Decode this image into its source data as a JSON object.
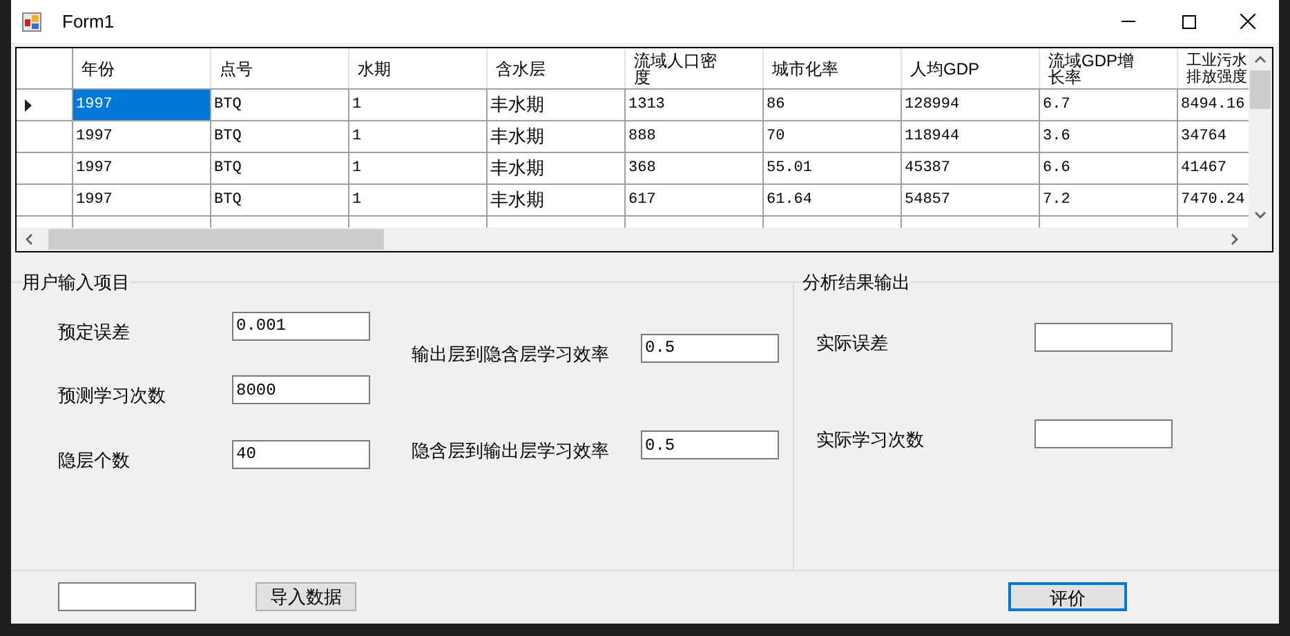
{
  "window": {
    "title": "Form1"
  },
  "table": {
    "columns": [
      "年份",
      "点号",
      "水期",
      "含水层",
      "流域人口密度",
      "城市化率",
      "人均GDP",
      "流域GDP增长率",
      "工业污水排放强度"
    ],
    "rows": [
      {
        "current": true,
        "cells": [
          {
            "text": "1997",
            "selected": true
          },
          {
            "text": "BTQ",
            "selected": false
          },
          {
            "text": "1",
            "selected": false
          },
          {
            "text": "丰水期",
            "selected": false
          },
          {
            "text": "1313",
            "selected": false
          },
          {
            "text": "86",
            "selected": false
          },
          {
            "text": "128994",
            "selected": false
          },
          {
            "text": "6.7",
            "selected": false
          },
          {
            "text": "8494.16",
            "selected": false
          }
        ]
      },
      {
        "current": false,
        "cells": [
          {
            "text": "1997",
            "selected": false
          },
          {
            "text": "BTQ",
            "selected": false
          },
          {
            "text": "1",
            "selected": false
          },
          {
            "text": "丰水期",
            "selected": false
          },
          {
            "text": "888",
            "selected": false
          },
          {
            "text": "70",
            "selected": false
          },
          {
            "text": "118944",
            "selected": false
          },
          {
            "text": "3.6",
            "selected": false
          },
          {
            "text": "34764",
            "selected": false
          }
        ]
      },
      {
        "current": false,
        "cells": [
          {
            "text": "1997",
            "selected": false
          },
          {
            "text": "BTQ",
            "selected": false
          },
          {
            "text": "1",
            "selected": false
          },
          {
            "text": "丰水期",
            "selected": false
          },
          {
            "text": "368",
            "selected": false
          },
          {
            "text": "55.01",
            "selected": false
          },
          {
            "text": "45387",
            "selected": false
          },
          {
            "text": "6.6",
            "selected": false
          },
          {
            "text": "41467",
            "selected": false
          }
        ]
      },
      {
        "current": false,
        "cells": [
          {
            "text": "1997",
            "selected": false
          },
          {
            "text": "BTQ",
            "selected": false
          },
          {
            "text": "1",
            "selected": false
          },
          {
            "text": "丰水期",
            "selected": false
          },
          {
            "text": "617",
            "selected": false
          },
          {
            "text": "61.64",
            "selected": false
          },
          {
            "text": "54857",
            "selected": false
          },
          {
            "text": "7.2",
            "selected": false
          },
          {
            "text": "7470.24",
            "selected": false
          }
        ]
      }
    ]
  },
  "input_group": {
    "title": "用户输入项目",
    "left_fields": [
      {
        "label": "预定误差",
        "value": "0.001"
      },
      {
        "label": "预测学习次数",
        "value": "8000"
      },
      {
        "label": "隐层个数",
        "value": "40"
      }
    ],
    "right_fields": [
      {
        "label": "输出层到隐含层学习效率",
        "value": "0.5"
      },
      {
        "label": "隐含层到输出层学习效率",
        "value": "0.5"
      }
    ]
  },
  "output_group": {
    "title": "分析结果输出",
    "fields": [
      {
        "label": "实际误差"
      },
      {
        "label": "实际学习次数"
      }
    ]
  },
  "buttons": [
    {
      "label": "导入数据",
      "focused": false
    },
    {
      "label": "评价",
      "focused": true
    }
  ]
}
